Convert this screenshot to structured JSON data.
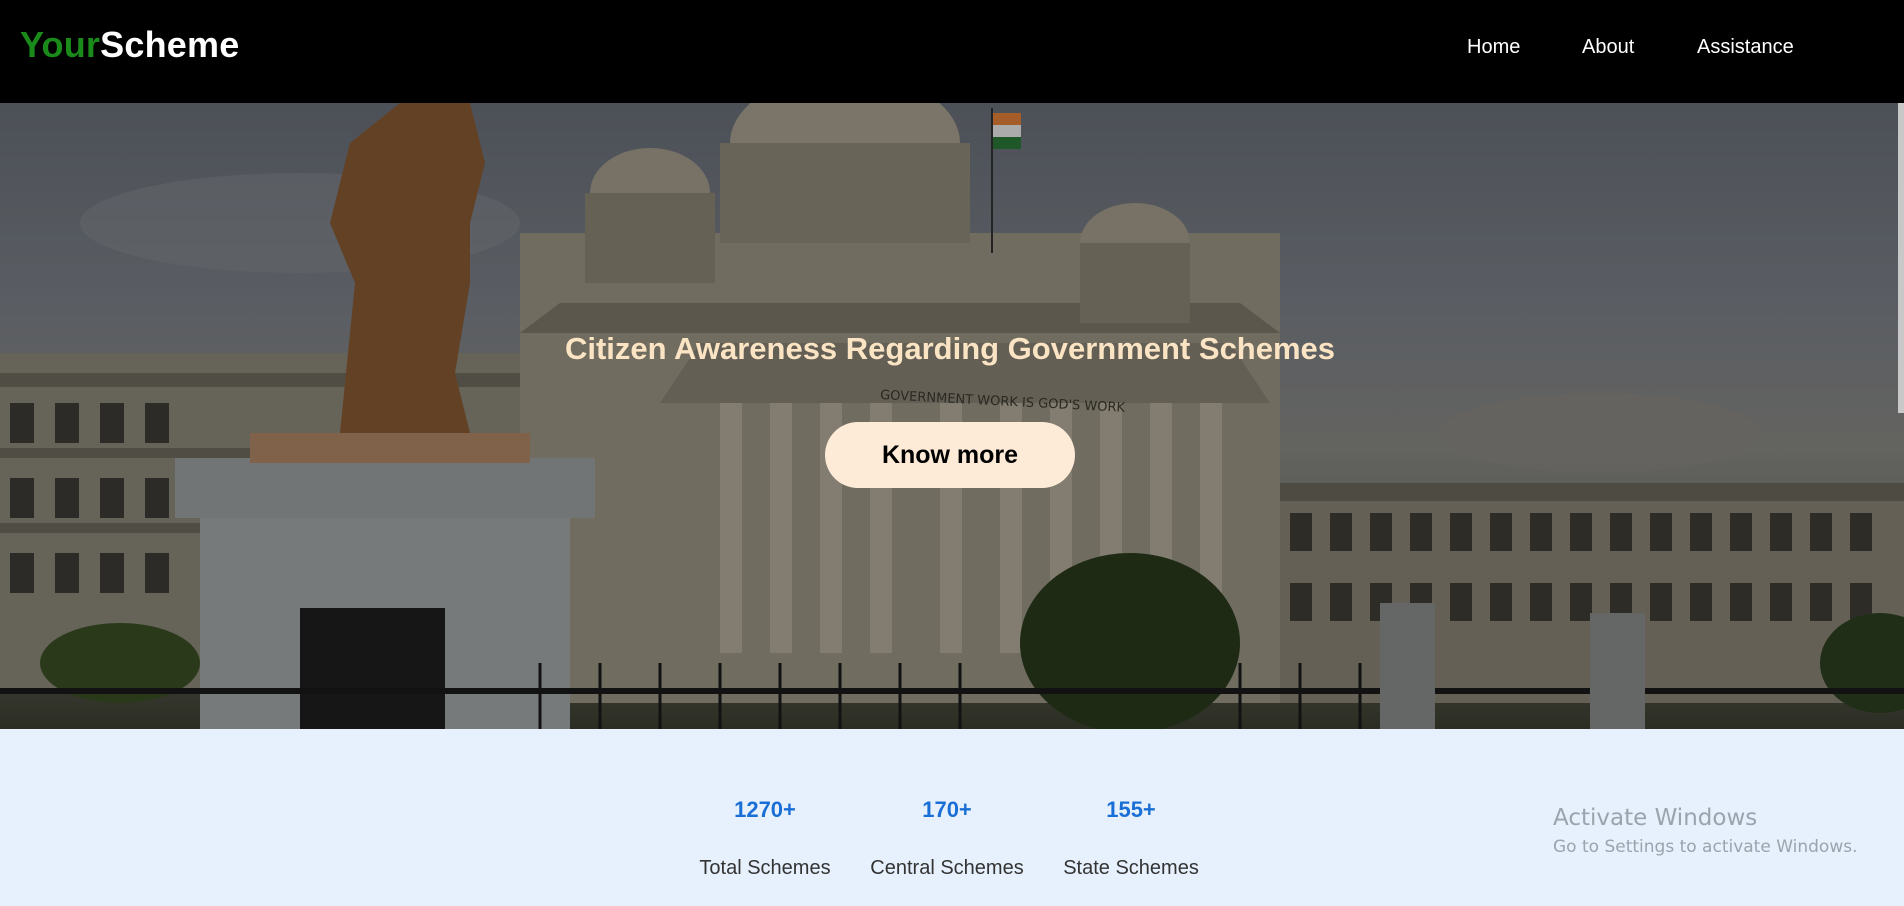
{
  "brand": {
    "part1": "Your",
    "part2": "Scheme"
  },
  "nav": {
    "home": "Home",
    "about": "About",
    "assistance": "Assistance"
  },
  "hero": {
    "title": "Citizen Awareness Regarding Government Schemes",
    "button_label": "Know more",
    "building_inscription": "GOVERNMENT WORK IS GOD'S WORK"
  },
  "stats": [
    {
      "value": "1270+",
      "label": "Total Schemes"
    },
    {
      "value": "170+",
      "label": "Central Schemes"
    },
    {
      "value": "155+",
      "label": "State Schemes"
    }
  ],
  "watermark": {
    "line1": "Activate Windows",
    "line2": "Go to Settings to activate Windows."
  },
  "colors": {
    "brand_green": "#1a8a1a",
    "stat_blue": "#1a6fd6",
    "hero_title": "#fbe4c4",
    "button_bg": "#fdebd7",
    "stats_bg": "#e6f1fd"
  }
}
